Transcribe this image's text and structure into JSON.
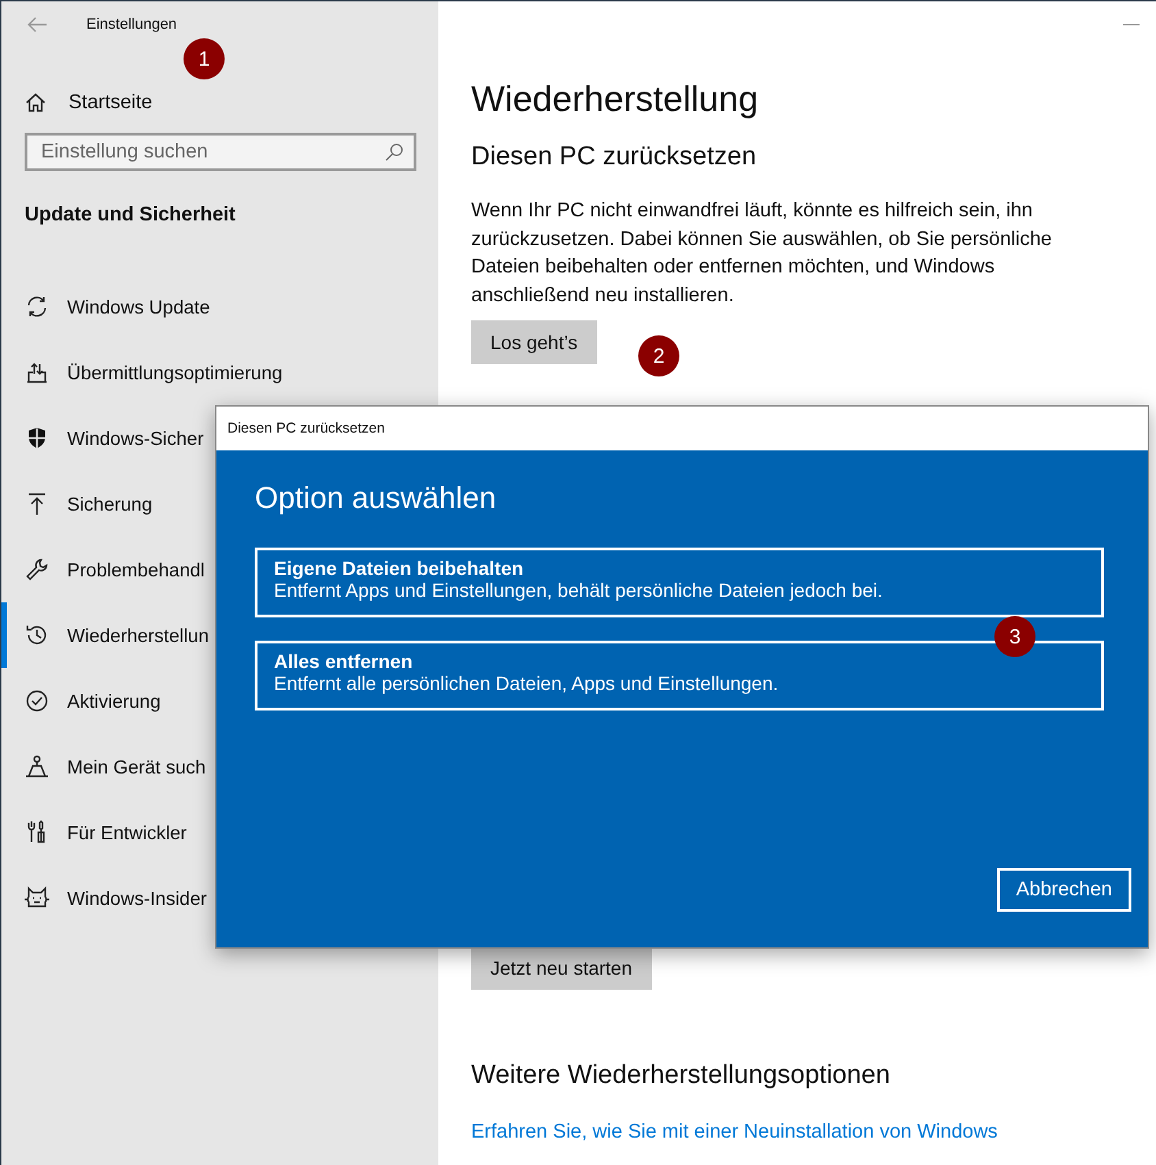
{
  "window": {
    "title": "Einstellungen"
  },
  "sidebar": {
    "home": "Startseite",
    "search": {
      "placeholder": "Einstellung suchen"
    },
    "section": "Update und Sicherheit",
    "items": [
      {
        "label": "Windows Update",
        "selected": false
      },
      {
        "label": "Übermittlungsoptimierung",
        "selected": false
      },
      {
        "label": "Windows-Sicher",
        "selected": false
      },
      {
        "label": "Sicherung",
        "selected": false
      },
      {
        "label": "Problembehandl",
        "selected": false
      },
      {
        "label": "Wiederherstellun",
        "selected": true
      },
      {
        "label": "Aktivierung",
        "selected": false
      },
      {
        "label": "Mein Gerät such",
        "selected": false
      },
      {
        "label": "Für Entwickler",
        "selected": false
      },
      {
        "label": "Windows-Insider",
        "selected": false
      }
    ]
  },
  "main": {
    "title": "Wiederherstellung",
    "reset_heading": "Diesen PC zurücksetzen",
    "reset_text": "Wenn Ihr PC nicht einwandfrei läuft, könnte es hilfreich sein, ihn zurückzusetzen. Dabei können Sie auswählen, ob Sie persönliche Dateien beibehalten oder entfernen möchten, und Windows anschließend neu installieren.",
    "reset_button": "Los geht’s",
    "restart_button": "Jetzt neu starten",
    "more_heading": "Weitere Wiederherstellungsoptionen",
    "link": "Erfahren Sie, wie Sie mit einer Neuinstallation von Windows"
  },
  "dialog": {
    "title": "Diesen PC zurücksetzen",
    "heading": "Option auswählen",
    "options": [
      {
        "title": "Eigene Dateien beibehalten",
        "description": "Entfernt Apps und Einstellungen, behält persönliche Dateien jedoch bei."
      },
      {
        "title": "Alles entfernen",
        "description": "Entfernt alle persönlichen Dateien, Apps und Einstellungen."
      }
    ],
    "cancel": "Abbrechen"
  },
  "markers": [
    "1",
    "2",
    "3"
  ]
}
